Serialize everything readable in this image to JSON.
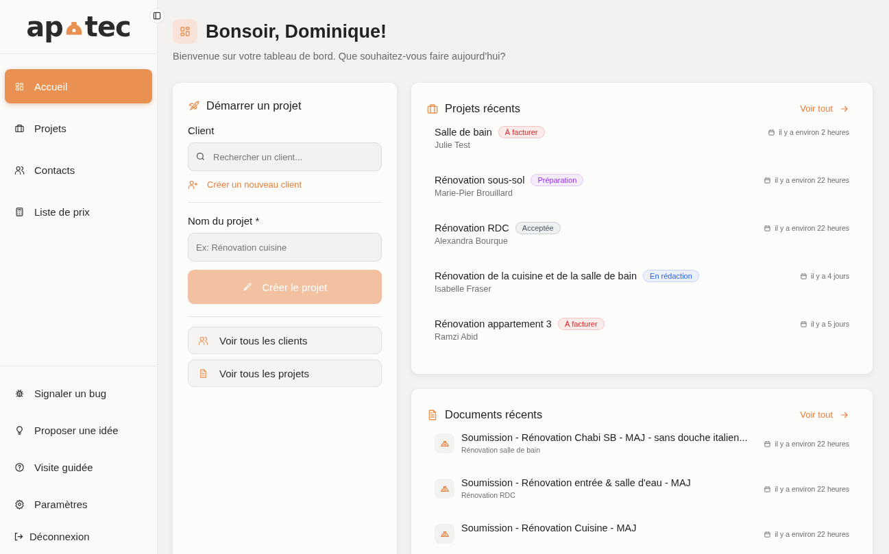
{
  "sidebar": {
    "logo": {
      "left": "ap",
      "right": "tec"
    },
    "nav": [
      {
        "label": "Accueil",
        "kind": "grid",
        "selected": true
      },
      {
        "label": "Projets",
        "kind": "briefcase",
        "selected": false
      },
      {
        "label": "Contacts",
        "kind": "users",
        "selected": false
      },
      {
        "label": "Liste de prix",
        "kind": "calculator",
        "selected": false
      }
    ],
    "footer": [
      {
        "label": "Signaler un bug",
        "kind": "bug"
      },
      {
        "label": "Proposer une idée",
        "kind": "bulb"
      },
      {
        "label": "Visite guidée",
        "kind": "help"
      },
      {
        "label": "Paramètres",
        "kind": "settings"
      }
    ],
    "logout": "Déconnexion"
  },
  "header": {
    "title": "Bonsoir, Dominique!",
    "subtitle": "Bienvenue sur votre tableau de bord. Que souhaitez-vous faire aujourd'hui?"
  },
  "start_project": {
    "title": "Démarrer un projet",
    "client_label": "Client",
    "client_search": {
      "placeholder": "Rechercher un client..."
    },
    "new_client": "Créer un nouveau client",
    "name_label": "Nom du projet *",
    "name_field": {
      "placeholder": "Ex: Rénovation cuisine"
    },
    "create_button": {
      "label": "Créer le projet",
      "disabled": true
    },
    "links": [
      {
        "label": "Voir tous les clients",
        "kind": "users"
      },
      {
        "label": "Voir tous les projets",
        "kind": "file"
      }
    ]
  },
  "recent_projects": {
    "title": "Projets récents",
    "see_all": "Voir tout",
    "items": [
      {
        "name": "Salle de bain",
        "status": "À facturer",
        "color": "#dc2626",
        "client": "Julie Test",
        "time": "il y a environ 2 heures"
      },
      {
        "name": "Rénovation sous-sol",
        "status": "Préparation",
        "color": "#9333ea",
        "client": "Marie-Pier Brouillard",
        "time": "il y a environ 22 heures"
      },
      {
        "name": "Rénovation RDC",
        "status": "Acceptée",
        "color": "#4b5563",
        "client": "Alexandra Bourque",
        "time": "il y a environ 22 heures"
      },
      {
        "name": "Rénovation de la cuisine et de la salle de bain",
        "status": "En rédaction",
        "color": "#2563eb",
        "client": "Isabelle Fraser",
        "time": "il y a 4 jours"
      },
      {
        "name": "Rénovation appartement 3",
        "status": "À facturer",
        "color": "#dc2626",
        "client": "Ramzi Abid",
        "time": "il y a 5 jours"
      }
    ]
  },
  "recent_documents": {
    "title": "Documents récents",
    "see_all": "Voir tout",
    "items": [
      {
        "name": "Soumission - Rénovation Chabi SB - MAJ - sans douche italien...",
        "project": "Rénovation salle de bain",
        "time": "il y a environ 22 heures"
      },
      {
        "name": "Soumission - Rénovation entrée & salle d'eau - MAJ",
        "project": "Rénovation RDC",
        "time": "il y a environ 22 heures"
      },
      {
        "name": "Soumission - Rénovation Cuisine - MAJ",
        "time": "il y a environ 22 heures"
      }
    ]
  }
}
